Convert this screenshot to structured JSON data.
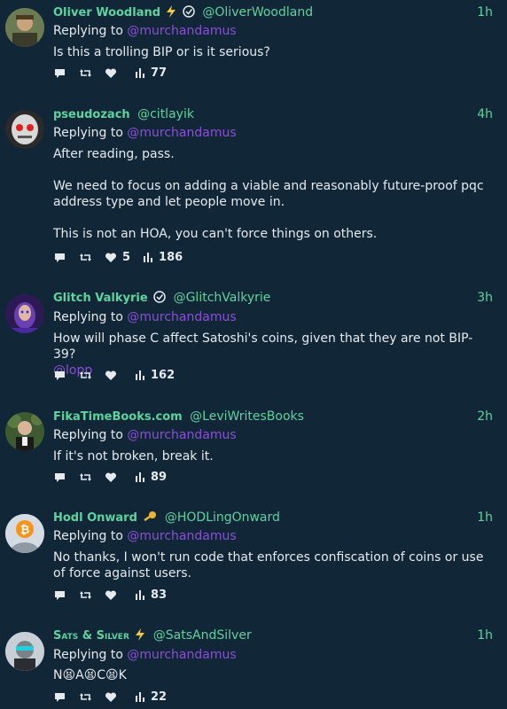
{
  "replying_prefix": "Replying to",
  "tweets": [
    {
      "name": "Oliver Woodland",
      "handle": "@OliverWoodland",
      "time": "1h",
      "mention": "@murchandamus",
      "body": [
        "Is this a trolling BIP or is it serious?"
      ],
      "likes": "",
      "views": "77",
      "badges": [
        "lightning-icon",
        "verified-icon"
      ]
    },
    {
      "name": "pseudozach",
      "handle": "@citlayik",
      "time": "4h",
      "mention": "@murchandamus",
      "body": [
        "After reading, pass.",
        "We need to focus on adding a viable and reasonably future-proof pqc address type and let people move in.",
        "This is not an HOA, you can't force things on others."
      ],
      "likes": "5",
      "views": "186",
      "badges": []
    },
    {
      "name": "Glitch Valkyrie",
      "handle": "@GlitchValkyrie",
      "time": "3h",
      "mention": "@murchandamus",
      "body": [
        "How will phase C affect Satoshi's coins, given that they are not BIP-39?"
      ],
      "body_mention": "@lopp",
      "likes": "",
      "views": "162",
      "badges": [
        "verified-icon"
      ]
    },
    {
      "name": "FikaTimeBooks.com",
      "handle": "@LeviWritesBooks",
      "time": "2h",
      "mention": "@murchandamus",
      "body": [
        "If it's not broken, break it."
      ],
      "likes": "",
      "views": "89",
      "badges": []
    },
    {
      "name": "Hodl Onward",
      "handle": "@HODLingOnward",
      "time": "1h",
      "mention": "@murchandamus",
      "body": [
        "No thanks, I won't run code that enforces confiscation of coins or use of force against users."
      ],
      "likes": "",
      "views": "83",
      "badges": [
        "key-icon"
      ]
    },
    {
      "name": "Sats & Silver",
      "handle": "@SatsAndSilver",
      "time": "1h",
      "mention": "@murchandamus",
      "body": [
        "N😫A😫C😫K"
      ],
      "likes": "",
      "views": "22",
      "badges": [
        "lightning-icon"
      ]
    }
  ],
  "colors": {
    "background": "#112637",
    "accent_green": "#5dd39e",
    "mention_purple": "#8a4fd6",
    "text": "#e6eaee"
  }
}
